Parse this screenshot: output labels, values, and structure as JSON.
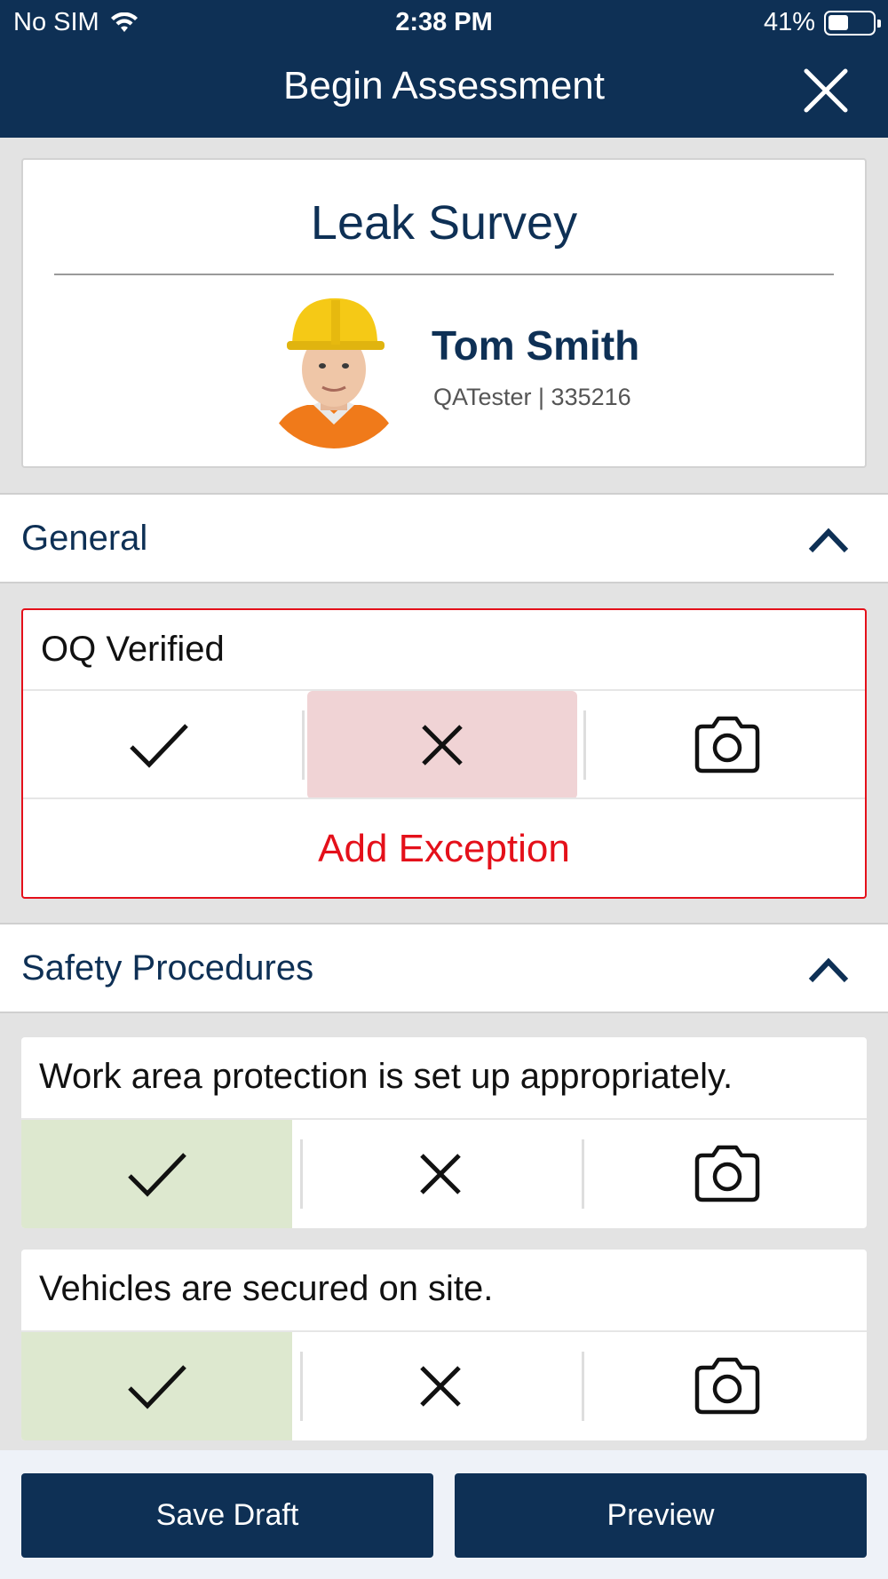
{
  "status_bar": {
    "carrier": "No SIM",
    "time": "2:38 PM",
    "battery": "41%"
  },
  "header": {
    "title": "Begin Assessment"
  },
  "profile": {
    "survey_title": "Leak Survey",
    "name": "Tom Smith",
    "role": "QATester | 335216"
  },
  "sections": [
    {
      "label": "General",
      "questions": [
        {
          "text": "OQ Verified",
          "selected": "fail",
          "exception_label": "Add Exception"
        }
      ]
    },
    {
      "label": "Safety Procedures",
      "questions": [
        {
          "text": "Work area protection is set up appropriately.",
          "selected": "pass"
        },
        {
          "text": "Vehicles are secured on site.",
          "selected": "pass"
        }
      ]
    }
  ],
  "footer": {
    "save_label": "Save Draft",
    "preview_label": "Preview"
  },
  "colors": {
    "brand_navy": "#0e3055",
    "error_red": "#e4101a",
    "pass_green_bg": "#dde8cf",
    "fail_red_bg": "#f0d3d5"
  }
}
